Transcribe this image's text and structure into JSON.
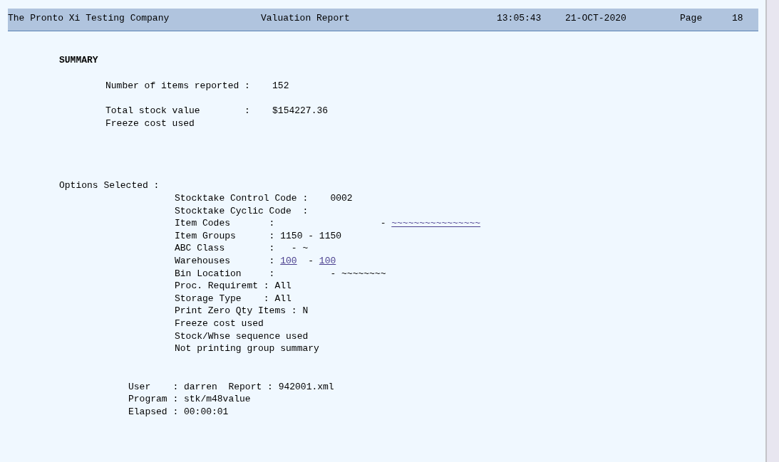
{
  "header": {
    "company": "The Pronto Xi Testing Company",
    "title": "Valuation Report",
    "time": "13:05:43",
    "date": "21-OCT-2020",
    "page_label": "Page",
    "page_number": "18"
  },
  "summary": {
    "heading": "SUMMARY",
    "items_line": "Number of items reported :    152",
    "value_line": "Total stock value        :    $154227.36",
    "cost_line": "Freeze cost used"
  },
  "options": {
    "label": "Options Selected :",
    "lines": [
      [
        {
          "text": "Stocktake Control Code :    0002",
          "link": false
        }
      ],
      [
        {
          "text": "Stocktake Cyclic Code  :",
          "link": false
        }
      ],
      [
        {
          "text": "Item Codes       :                   - ",
          "link": false
        },
        {
          "text": "~~~~~~~~~~~~~~~~",
          "link": true
        }
      ],
      [
        {
          "text": "Item Groups      : 1150 - 1150",
          "link": false
        }
      ],
      [
        {
          "text": "ABC Class        :   - ~",
          "link": false
        }
      ],
      [
        {
          "text": "Warehouses       : ",
          "link": false
        },
        {
          "text": "100",
          "link": true
        },
        {
          "text": "  - ",
          "link": false
        },
        {
          "text": "100",
          "link": true
        }
      ],
      [
        {
          "text": "Bin Location     :          - ~~~~~~~~",
          "link": false
        }
      ],
      [
        {
          "text": "Proc. Requiremt : All",
          "link": false
        }
      ],
      [
        {
          "text": "Storage Type    : All",
          "link": false
        }
      ],
      [
        {
          "text": "Print Zero Qty Items : N",
          "link": false
        }
      ],
      [
        {
          "text": "Freeze cost used",
          "link": false
        }
      ],
      [
        {
          "text": "Stock/Whse sequence used",
          "link": false
        }
      ],
      [
        {
          "text": "Not printing group summary",
          "link": false
        }
      ]
    ]
  },
  "footer": [
    "User    : darren  Report : 942001.xml",
    "Program : stk/m48value",
    "Elapsed : 00:00:01"
  ]
}
